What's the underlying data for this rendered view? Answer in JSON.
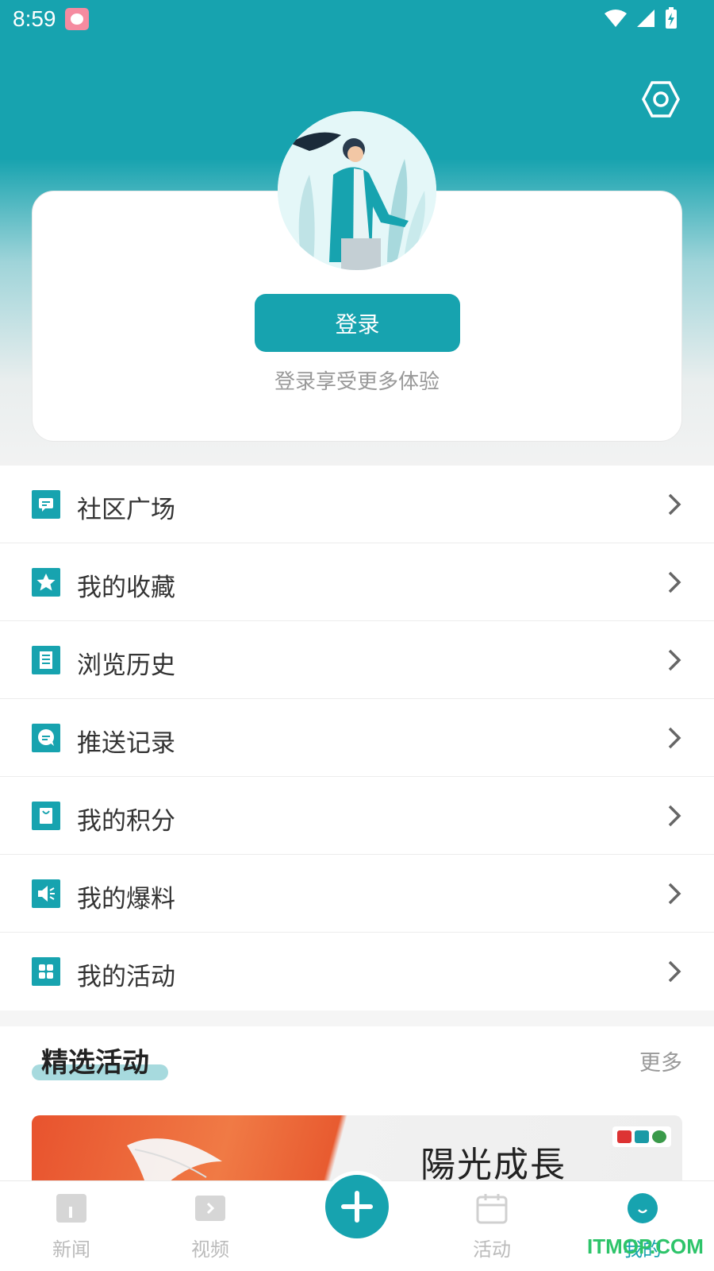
{
  "status_bar": {
    "time": "8:59"
  },
  "profile": {
    "login_label": "登录",
    "login_hint": "登录享受更多体验"
  },
  "menu": {
    "items": [
      {
        "label": "社区广场",
        "icon": "chat-bubble-icon"
      },
      {
        "label": "我的收藏",
        "icon": "star-icon"
      },
      {
        "label": "浏览历史",
        "icon": "document-list-icon"
      },
      {
        "label": "推送记录",
        "icon": "message-icon"
      },
      {
        "label": "我的积分",
        "icon": "bag-icon"
      },
      {
        "label": "我的爆料",
        "icon": "speaker-icon"
      },
      {
        "label": "我的活动",
        "icon": "grid-icon"
      }
    ]
  },
  "featured": {
    "title": "精选活动",
    "more_label": "更多",
    "banner_text": "陽光成長"
  },
  "tabbar": {
    "tabs": [
      {
        "label": "新闻",
        "icon": "news-icon"
      },
      {
        "label": "视频",
        "icon": "video-icon"
      },
      {
        "label": "add",
        "icon": "plus-icon"
      },
      {
        "label": "活动",
        "icon": "calendar-icon"
      },
      {
        "label": "我的",
        "icon": "profile-icon"
      }
    ]
  },
  "watermark": "ITMOP.COM",
  "colors": {
    "accent": "#17a3af",
    "accent_light": "#a7dade"
  }
}
